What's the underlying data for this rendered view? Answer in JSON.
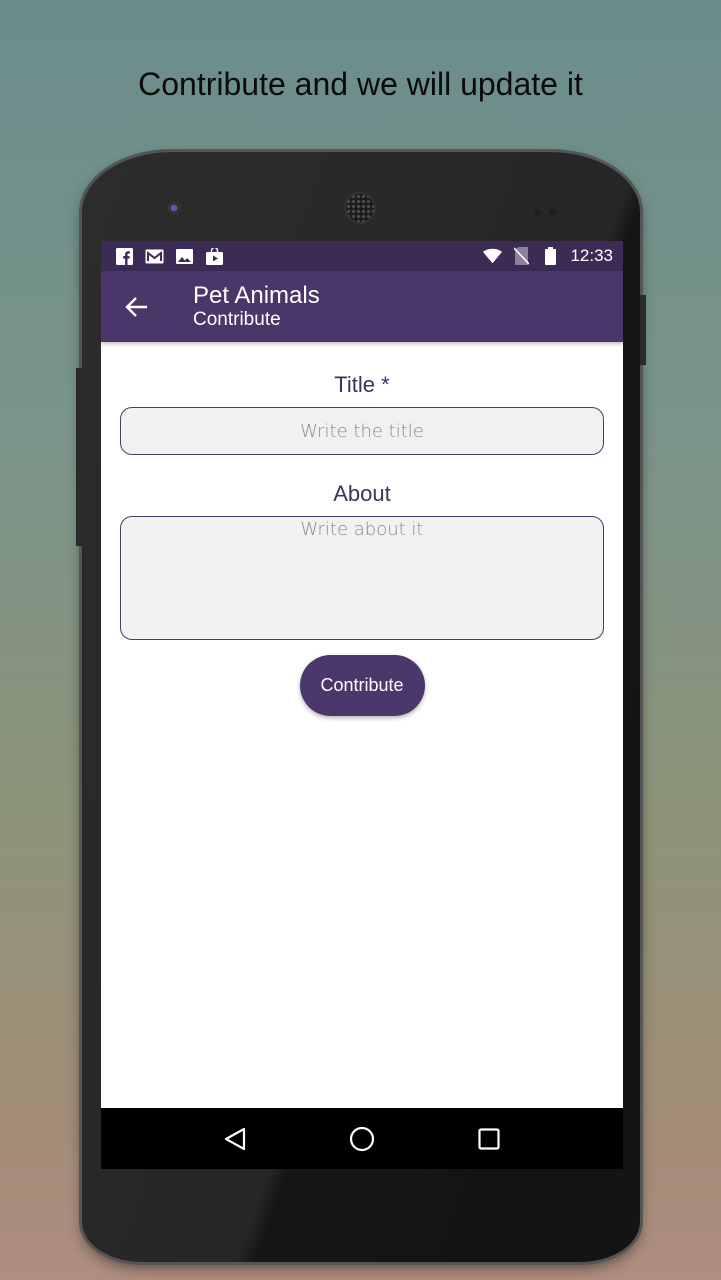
{
  "promo": {
    "headline": "Contribute and we will update it"
  },
  "status_bar": {
    "notification_icons": [
      "facebook-icon",
      "gmail-icon",
      "image-icon",
      "play-store-icon"
    ],
    "system_icons": [
      "wifi-icon",
      "no-sim-icon",
      "battery-icon"
    ],
    "time": "12:33"
  },
  "app_bar": {
    "title": "Pet Animals",
    "subtitle": "Contribute",
    "back_icon": "arrow-left-icon"
  },
  "form": {
    "title_label": "Title *",
    "title_value": "",
    "title_placeholder": "Write the title",
    "about_label": "About",
    "about_value": "",
    "about_placeholder": "Write about it",
    "submit_label": "Contribute"
  },
  "nav_bar": {
    "buttons": [
      "back-triangle-icon",
      "home-circle-icon",
      "recents-square-icon"
    ]
  },
  "colors": {
    "primary": "#4a3668",
    "primary_dark": "#3b2b55",
    "label_text": "#3f3160",
    "input_bg": "#f1f1f1"
  }
}
